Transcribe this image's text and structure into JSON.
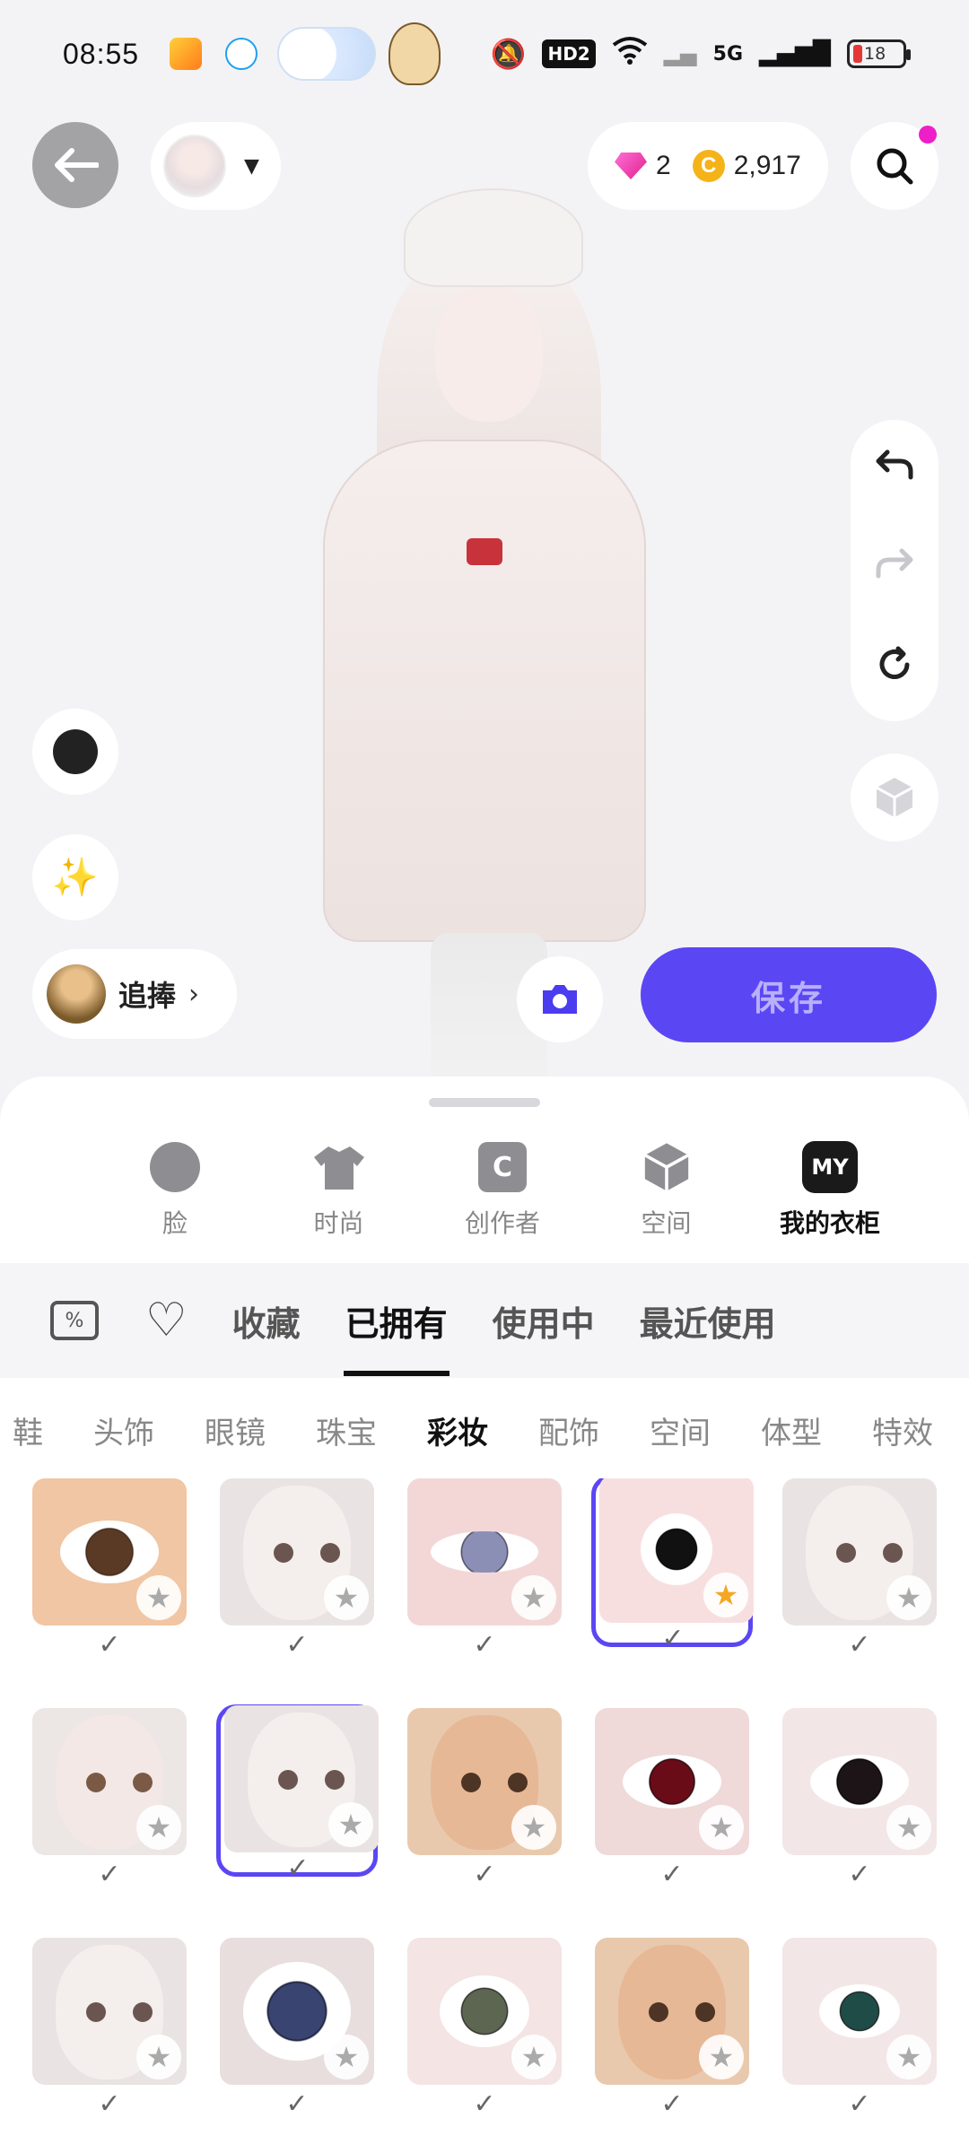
{
  "status_bar": {
    "time": "08:55",
    "network": "5G",
    "hd_badge": "HD2",
    "battery": "18"
  },
  "header": {
    "back_icon": "arrow-left-icon",
    "gems": "2",
    "coins": "2,917",
    "coin_glyph": "C",
    "search_icon": "search-icon"
  },
  "controls": {
    "follow_label": "追捧",
    "save_label": "保存",
    "camera_icon": "camera-icon"
  },
  "categories": [
    {
      "label": "脸",
      "icon": "face-icon"
    },
    {
      "label": "时尚",
      "icon": "shirt-icon"
    },
    {
      "label": "创作者",
      "icon": "bag-icon",
      "glyph": "C"
    },
    {
      "label": "空间",
      "icon": "cube-icon"
    },
    {
      "label": "我的衣柜",
      "icon": "my-icon",
      "glyph": "MY",
      "active": true
    }
  ],
  "filters": {
    "tabs": [
      "收藏",
      "已拥有",
      "使用中",
      "最近使用"
    ],
    "active": "已拥有"
  },
  "subcategories": {
    "items": [
      "鞋",
      "头饰",
      "眼镜",
      "珠宝",
      "彩妆",
      "配饰",
      "空间",
      "体型",
      "特效"
    ],
    "active": "彩妆"
  },
  "items": [
    {
      "kind": "eye-closeup-warm",
      "owned": true,
      "favorite": false,
      "selected": false
    },
    {
      "kind": "face-pale",
      "owned": true,
      "favorite": false,
      "selected": false
    },
    {
      "kind": "eye-closeup-blue",
      "owned": true,
      "favorite": false,
      "selected": false
    },
    {
      "kind": "eye-black",
      "owned": true,
      "favorite": true,
      "selected": true
    },
    {
      "kind": "face-pale",
      "owned": true,
      "favorite": false,
      "selected": false
    },
    {
      "kind": "face-doll",
      "owned": true,
      "favorite": false,
      "selected": false
    },
    {
      "kind": "face-pale",
      "owned": true,
      "favorite": false,
      "selected": true
    },
    {
      "kind": "face-warm",
      "owned": true,
      "favorite": false,
      "selected": false
    },
    {
      "kind": "eye-red",
      "owned": true,
      "favorite": false,
      "selected": false
    },
    {
      "kind": "eye-dark",
      "owned": true,
      "favorite": false,
      "selected": false
    },
    {
      "kind": "face-pale",
      "owned": true,
      "favorite": false,
      "selected": false
    },
    {
      "kind": "eye-galaxy",
      "owned": true,
      "favorite": false,
      "selected": false
    },
    {
      "kind": "eye-green",
      "owned": true,
      "favorite": false,
      "selected": false
    },
    {
      "kind": "face-warm",
      "owned": true,
      "favorite": false,
      "selected": false
    },
    {
      "kind": "eye-teal",
      "owned": true,
      "favorite": false,
      "selected": false
    }
  ],
  "colors": {
    "accent": "#5b46f4",
    "favorite_star": "#f5a623",
    "notification_dot": "#ee1ec8"
  }
}
